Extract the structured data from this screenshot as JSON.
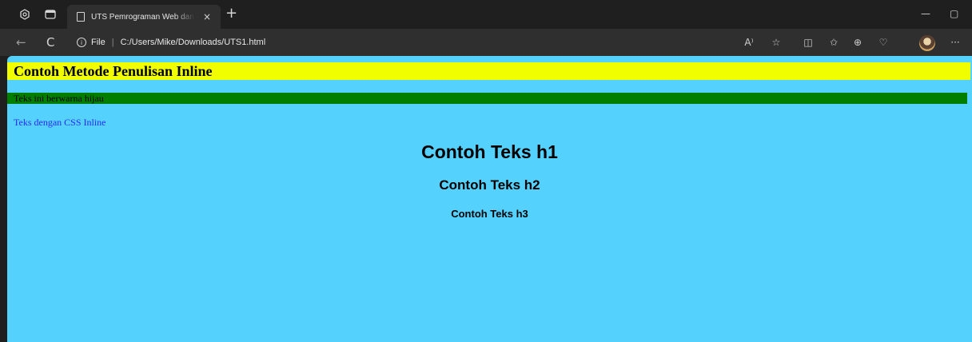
{
  "browser": {
    "tab": {
      "title": "UTS Pemrograman Web dan Mobile"
    },
    "address": {
      "scheme": "File",
      "separator": "|",
      "url": "C:/Users/Mike/Downloads/UTS1.html"
    },
    "icons": {
      "workspaces": "workspaces-icon",
      "tab_actions": "tab-actions-icon",
      "new_tab": "+",
      "minimize": "—",
      "restore": "▢",
      "back": "←",
      "refresh": "C",
      "info": "i",
      "read_aloud": "A⁾",
      "favorite": "☆",
      "split": "◫",
      "favorites": "✩",
      "collections": "⊕",
      "health": "♡",
      "more": "···",
      "close_tab": "×"
    }
  },
  "page": {
    "inline_heading": "Contoh Metode Penulisan Inline",
    "green_text": "Teks ini berwarna hijau",
    "blue_text": "Teks dengan CSS Inline",
    "h1": "Contoh Teks h1",
    "h2": "Contoh Teks h2",
    "h3": "Contoh Teks h3",
    "colors": {
      "background": "#55d1fd",
      "heading_bg": "#f0fe00",
      "green_bg": "#017e00",
      "blue_text": "#2929ff"
    }
  }
}
